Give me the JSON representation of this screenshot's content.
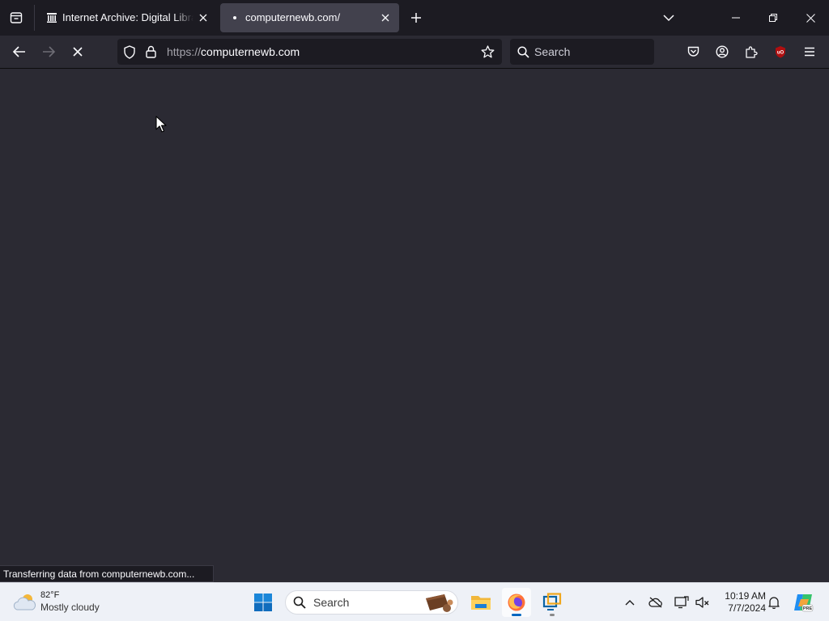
{
  "browser": {
    "tabs": [
      {
        "title": "Internet Archive: Digital Library of Free & Borrowable Books, Movies, Music & Wayback Machine",
        "active": false
      },
      {
        "title": "computernewb.com/",
        "active": true
      }
    ],
    "url": {
      "protocol": "https://",
      "host": "computernewb.com"
    },
    "search_placeholder": "Search",
    "status_text": "Transferring data from computernewb.com...",
    "loading": true
  },
  "taskbar": {
    "weather": {
      "temp": "82°F",
      "condition": "Mostly cloudy"
    },
    "search_placeholder": "Search",
    "clock": {
      "time": "10:19 AM",
      "date": "7/7/2024"
    },
    "apps": [
      "windows-start",
      "file-explorer",
      "firefox",
      "remote-desktop"
    ]
  },
  "colors": {
    "chrome_dark": "#1c1b22",
    "toolbar": "#2b2a33",
    "active_tab": "#42414d",
    "taskbar": "#eef1f7",
    "accent": "#0067c0"
  }
}
